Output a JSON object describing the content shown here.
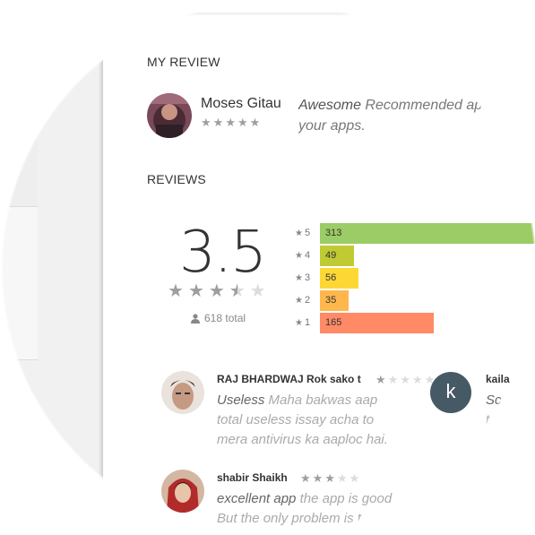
{
  "my_review": {
    "section_title": "MY REVIEW",
    "user_name": "Moses Gitau",
    "stars": 5,
    "text_lead": "Awesome",
    "text_rest": "Recommended ap",
    "text_line2": "your apps."
  },
  "reviews": {
    "section_title": "REVIEWS",
    "average": "3.5",
    "average_value": 3.5,
    "total_label": "618 total",
    "histogram": [
      {
        "stars": "5",
        "count": "313",
        "value": 313,
        "color": "#9ccc65"
      },
      {
        "stars": "4",
        "count": "49",
        "value": 49,
        "color": "#c0ca33"
      },
      {
        "stars": "3",
        "count": "56",
        "value": 56,
        "color": "#fdd835"
      },
      {
        "stars": "2",
        "count": "35",
        "value": 35,
        "color": "#ffb74d"
      },
      {
        "stars": "1",
        "count": "165",
        "value": 165,
        "color": "#ff8a65"
      }
    ],
    "items": [
      {
        "user_name": "RAJ BHARDWAJ Rok sako t",
        "rating": 1,
        "text_lead": "Useless",
        "text_rest": "Maha bakwas aap",
        "line2": "total useless issay acha to",
        "line3": "mera antivirus ka aaploc hai."
      },
      {
        "user_name": "shabir Shaikh",
        "rating": 3,
        "text_lead": "excellent app",
        "text_rest": "the app is good",
        "line2": "But the only problem is t"
      },
      {
        "user_name": "kaila",
        "avatar_letter": "k",
        "text_lead": "Sc",
        "line2": "t"
      }
    ]
  }
}
